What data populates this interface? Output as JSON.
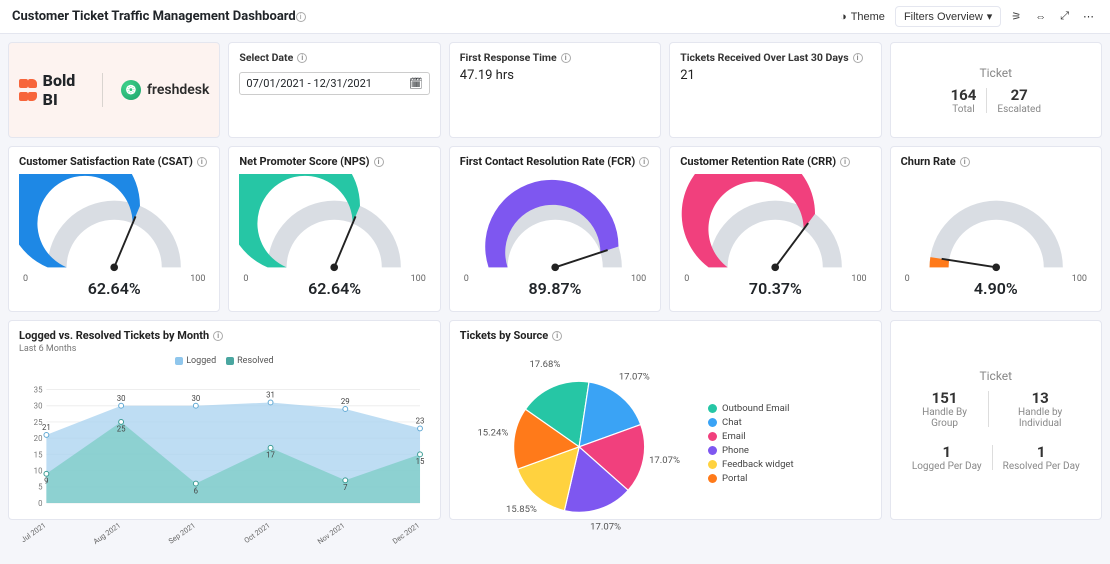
{
  "header": {
    "title": "Customer Ticket Traffic Management Dashboard",
    "theme_btn": "Theme",
    "filters_btn": "Filters Overview"
  },
  "row1": {
    "boldbi": "Bold BI",
    "freshdesk": "freshdesk",
    "select_date_label": "Select Date",
    "date_range": "07/01/2021 - 12/31/2021",
    "first_response_label": "First Response Time",
    "first_response_value": "47.19 hrs",
    "tickets30_label": "Tickets Received Over Last 30 Days",
    "tickets30_value": "21",
    "ticket_header": "Ticket",
    "ticket_total_num": "164",
    "ticket_total_lbl": "Total",
    "ticket_esc_num": "27",
    "ticket_esc_lbl": "Escalated"
  },
  "gauges": [
    {
      "title": "Customer Satisfaction Rate (CSAT)",
      "value": 62.64,
      "display": "62.64%",
      "min": "0",
      "max": "100",
      "color": "#1e88e5"
    },
    {
      "title": "Net Promoter Score (NPS)",
      "value": 62.64,
      "display": "62.64%",
      "min": "0",
      "max": "100",
      "color": "#26c6a5"
    },
    {
      "title": "First Contact Resolution Rate (FCR)",
      "value": 89.87,
      "display": "89.87%",
      "min": "0",
      "max": "100",
      "color": "#7e57f0"
    },
    {
      "title": "Customer Retention Rate (CRR)",
      "value": 70.37,
      "display": "70.37%",
      "min": "0",
      "max": "100",
      "color": "#f1407d"
    },
    {
      "title": "Churn Rate",
      "value": 4.9,
      "display": "4.90%",
      "min": "0",
      "max": "100",
      "color": "#ff7a1a"
    }
  ],
  "area_chart": {
    "title": "Logged vs. Resolved Tickets by Month",
    "subtitle": "Last 6 Months",
    "legend_logged": "Logged",
    "legend_resolved": "Resolved",
    "months": [
      "Jul 2021",
      "Aug 2021",
      "Sep 2021",
      "Oct 2021",
      "Nov 2021",
      "Dec 2021"
    ],
    "logged": [
      21,
      30,
      30,
      31,
      29,
      23
    ],
    "resolved": [
      9,
      25,
      6,
      17,
      7,
      15
    ],
    "y_ticks": [
      0,
      5,
      10,
      15,
      20,
      25,
      30,
      35
    ]
  },
  "pie": {
    "title": "Tickets by Source",
    "slices": [
      {
        "label": "Outbound Email",
        "pct": 17.68,
        "color": "#26c6a5"
      },
      {
        "label": "Chat",
        "pct": 17.07,
        "color": "#3aa3f5"
      },
      {
        "label": "Email",
        "pct": 17.07,
        "color": "#f1407d"
      },
      {
        "label": "Phone",
        "pct": 17.07,
        "color": "#7e57f0"
      },
      {
        "label": "Feedback widget",
        "pct": 15.85,
        "color": "#ffd23f"
      },
      {
        "label": "Portal",
        "pct": 15.24,
        "color": "#ff7a1a"
      }
    ]
  },
  "handle": {
    "header": "Ticket",
    "group_num": "151",
    "group_lbl": "Handle By Group",
    "indiv_num": "13",
    "indiv_lbl": "Handle by Individual",
    "logged_num": "1",
    "logged_lbl": "Logged Per Day",
    "resolved_num": "1",
    "resolved_lbl": "Resolved Per Day"
  },
  "chart_data": [
    {
      "type": "gauge",
      "title": "Customer Satisfaction Rate (CSAT)",
      "value": 62.64,
      "min": 0,
      "max": 100,
      "unit": "%"
    },
    {
      "type": "gauge",
      "title": "Net Promoter Score (NPS)",
      "value": 62.64,
      "min": 0,
      "max": 100,
      "unit": "%"
    },
    {
      "type": "gauge",
      "title": "First Contact Resolution Rate (FCR)",
      "value": 89.87,
      "min": 0,
      "max": 100,
      "unit": "%"
    },
    {
      "type": "gauge",
      "title": "Customer Retention Rate (CRR)",
      "value": 70.37,
      "min": 0,
      "max": 100,
      "unit": "%"
    },
    {
      "type": "gauge",
      "title": "Churn Rate",
      "value": 4.9,
      "min": 0,
      "max": 100,
      "unit": "%"
    },
    {
      "type": "area",
      "title": "Logged vs. Resolved Tickets by Month",
      "categories": [
        "Jul 2021",
        "Aug 2021",
        "Sep 2021",
        "Oct 2021",
        "Nov 2021",
        "Dec 2021"
      ],
      "series": [
        {
          "name": "Logged",
          "values": [
            21,
            30,
            30,
            31,
            29,
            23
          ]
        },
        {
          "name": "Resolved",
          "values": [
            9,
            25,
            6,
            17,
            7,
            15
          ]
        }
      ],
      "ylim": [
        0,
        35
      ]
    },
    {
      "type": "pie",
      "title": "Tickets by Source",
      "categories": [
        "Outbound Email",
        "Chat",
        "Email",
        "Phone",
        "Feedback widget",
        "Portal"
      ],
      "values": [
        17.68,
        17.07,
        17.07,
        17.07,
        15.85,
        15.24
      ],
      "unit": "%"
    }
  ]
}
